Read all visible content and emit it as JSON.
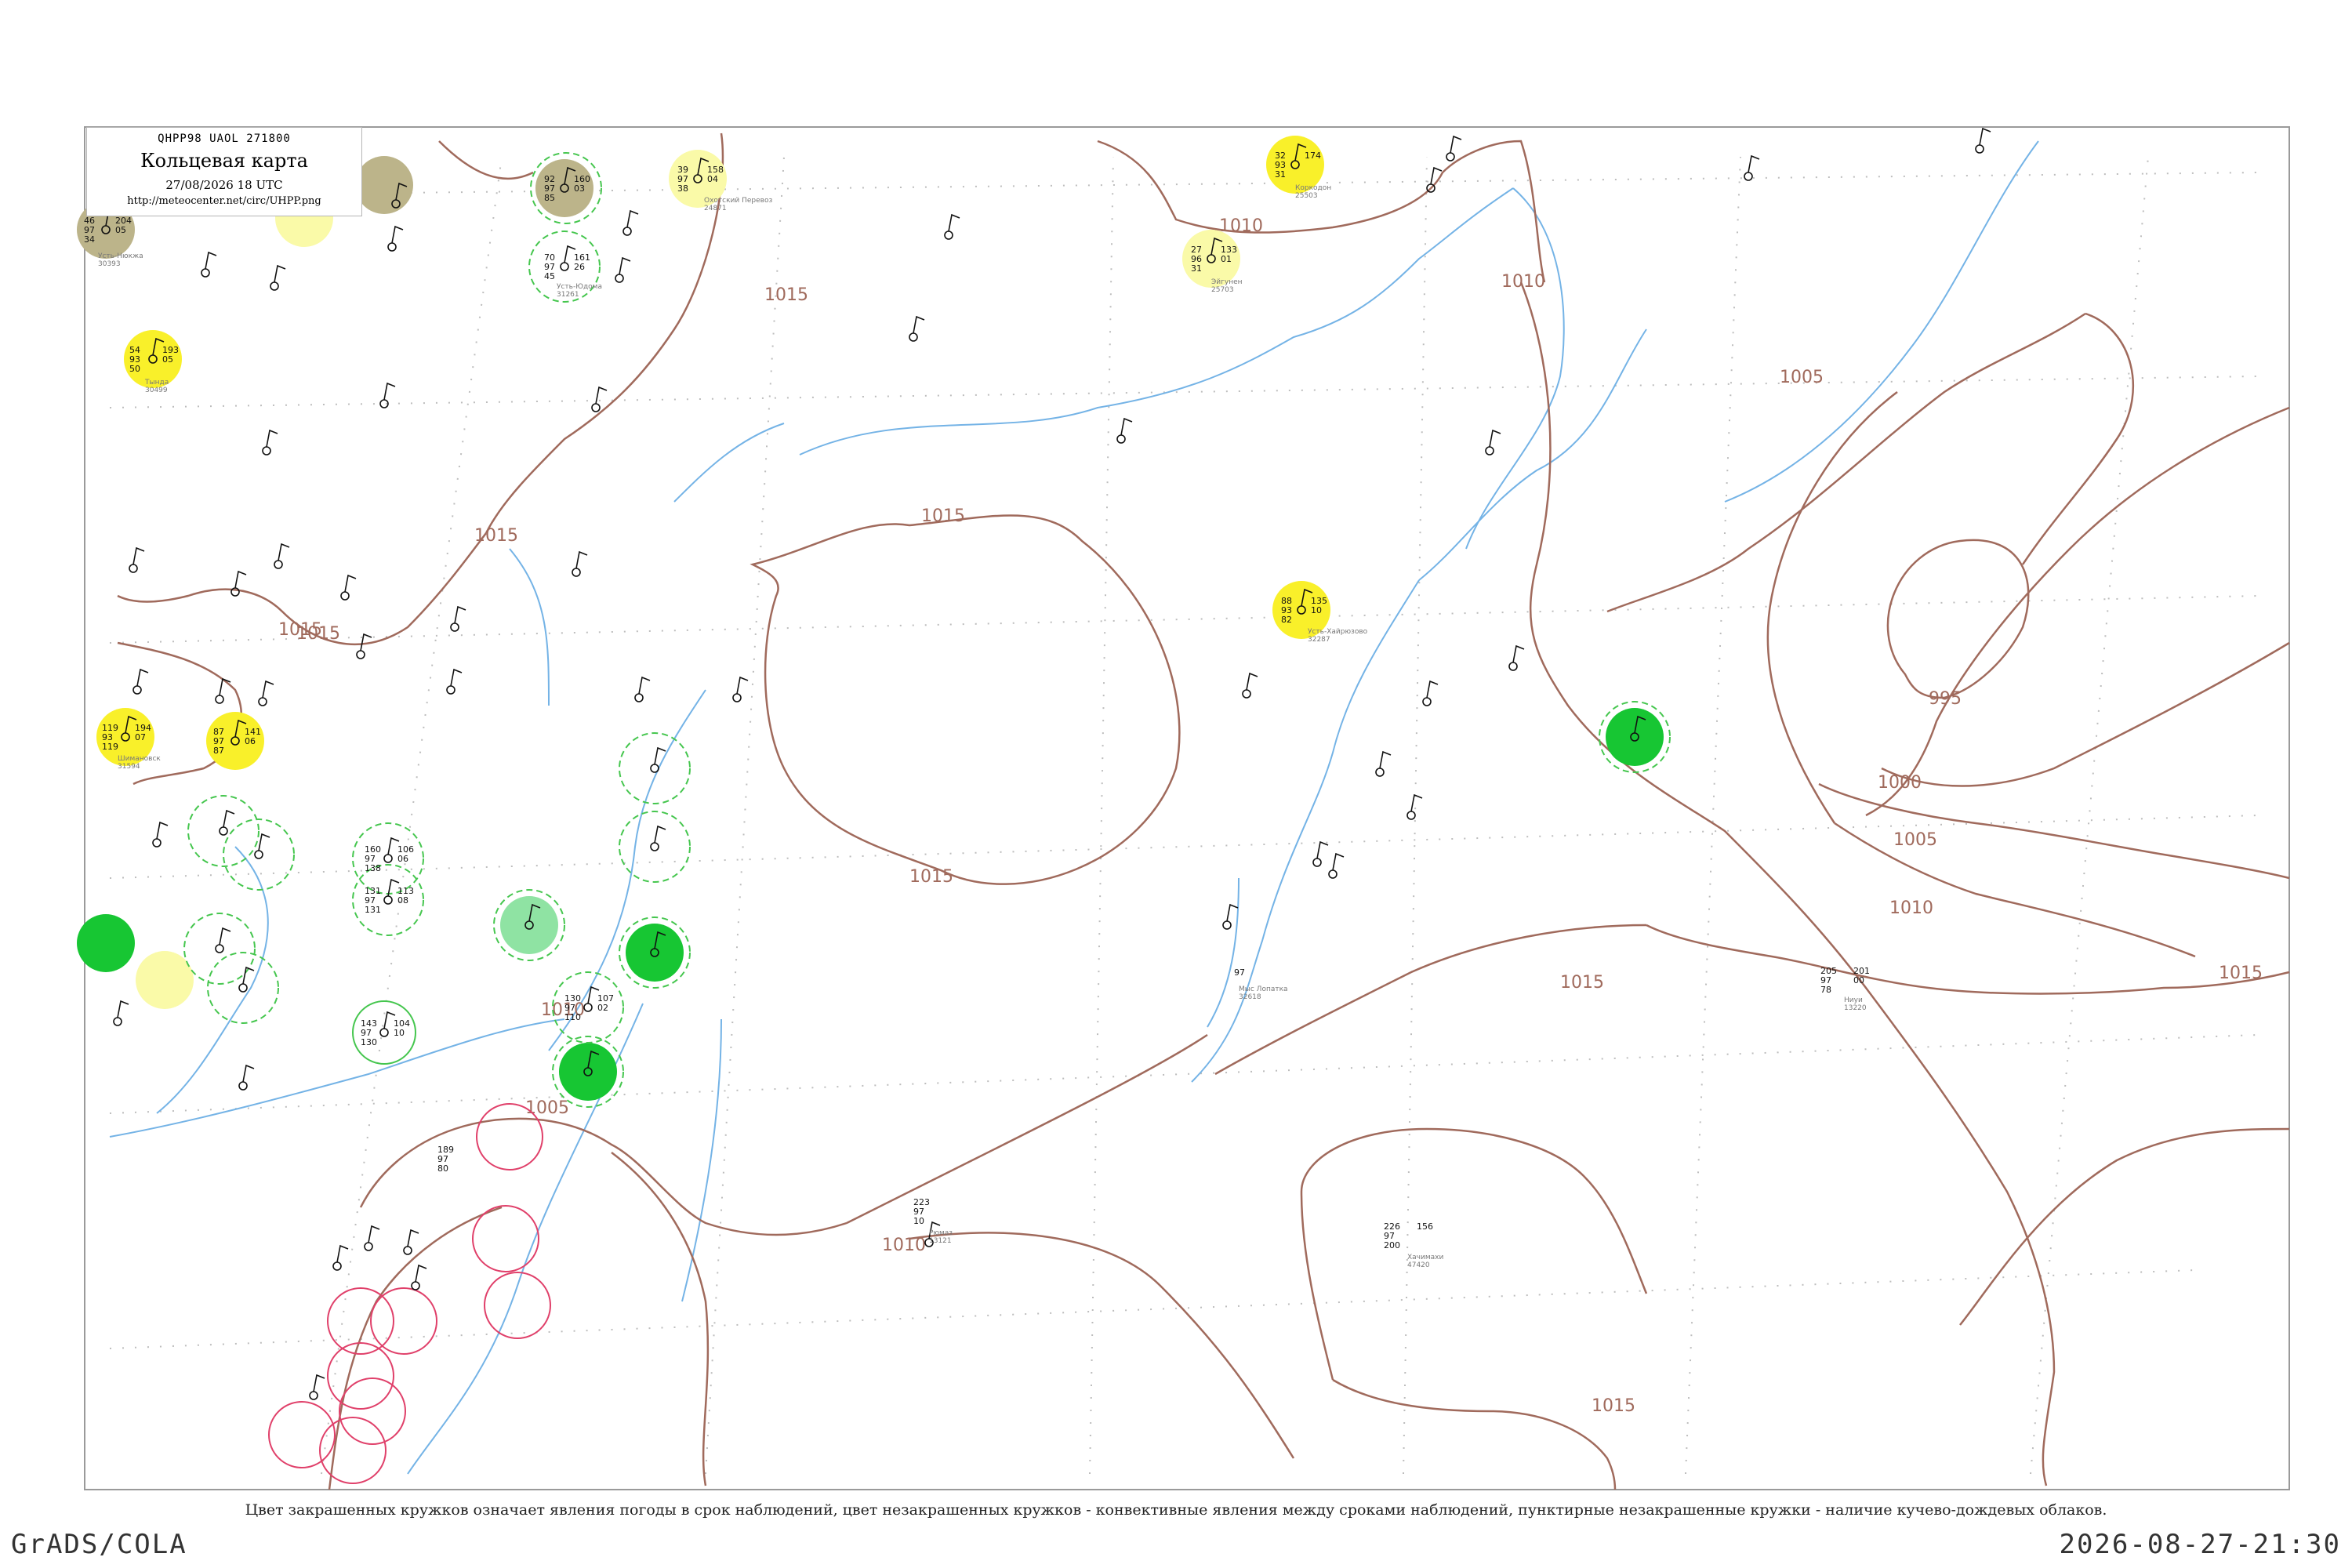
{
  "title": {
    "code": "QHPP98  UAOL  271800",
    "name": "Кольцевая карта",
    "datetime": "27/08/2026 18 UTC",
    "url": "http://meteocenter.net/circ/UHPP.png"
  },
  "isobar_labels": [
    "1015",
    "1015",
    "1015",
    "1015",
    "1015",
    "1010",
    "1010",
    "1010",
    "1010",
    "1010",
    "1005",
    "1005",
    "1005",
    "1000",
    "995",
    "1015",
    "1015",
    "1015",
    "1015"
  ],
  "stations": [
    {
      "top": "46",
      "mid": "97",
      "bot": "34",
      "right_top": "204",
      "right_bot": "05",
      "name": "Усть-Нюкжа",
      "code": "30393"
    },
    {
      "top": "54",
      "mid": "93",
      "bot": "50",
      "right_top": "193",
      "right_bot": "05",
      "name": "Тында",
      "code": "30499"
    },
    {
      "top": "119",
      "mid": "93",
      "bot": "119",
      "right_top": "194",
      "right_bot": "07",
      "name": "Шимановск",
      "code": "31594"
    },
    {
      "top": "87",
      "mid": "97",
      "bot": "87",
      "right_top": "141",
      "right_bot": "06",
      "name": "",
      "code": ""
    },
    {
      "top": "92",
      "mid": "97",
      "bot": "85",
      "right_top": "160",
      "right_bot": "03",
      "name": "",
      "code": ""
    },
    {
      "top": "70",
      "mid": "97",
      "bot": "45",
      "right_top": "161",
      "right_bot": "26",
      "name": "Усть-Юдома",
      "code": "31261"
    },
    {
      "top": "39",
      "mid": "97",
      "bot": "38",
      "right_top": "158",
      "right_bot": "04",
      "name": "Охотский Перевоз",
      "code": "24871"
    },
    {
      "top": "32",
      "mid": "93",
      "bot": "31",
      "right_top": "174",
      "right_bot": "",
      "name": "Коркодон",
      "code": "25503"
    },
    {
      "top": "27",
      "mid": "96",
      "bot": "31",
      "right_top": "133",
      "right_bot": "01",
      "name": "Эйгунен",
      "code": "25703"
    },
    {
      "top": "88",
      "mid": "93",
      "bot": "82",
      "right_top": "135",
      "right_bot": "10",
      "name": "Усть-Хайрюзово",
      "code": "32287"
    },
    {
      "top": "",
      "mid": "97",
      "bot": "",
      "right_top": "",
      "right_bot": "",
      "name": "Мыс Лопатка",
      "code": "32618"
    },
    {
      "top": "160",
      "mid": "97",
      "bot": "138",
      "right_top": "106",
      "right_bot": "06",
      "name": "",
      "code": ""
    },
    {
      "top": "131",
      "mid": "97",
      "bot": "131",
      "right_top": "113",
      "right_bot": "08",
      "name": "",
      "code": ""
    },
    {
      "top": "130",
      "mid": "97",
      "bot": "110",
      "right_top": "107",
      "right_bot": "02",
      "name": "",
      "code": ""
    },
    {
      "top": "143",
      "mid": "97",
      "bot": "130",
      "right_top": "104",
      "right_bot": "10",
      "name": "",
      "code": ""
    },
    {
      "top": "189",
      "mid": "97",
      "bot": "80",
      "right_top": "",
      "right_bot": "",
      "name": "",
      "code": ""
    },
    {
      "top": "223",
      "mid": "97",
      "bot": "10",
      "right_top": "",
      "right_bot": "",
      "name": "Рюмаз",
      "code": "13121"
    },
    {
      "top": "226",
      "mid": "97",
      "bot": "200",
      "right_top": "156",
      "right_bot": "",
      "name": "Хачимахи",
      "code": "47420"
    },
    {
      "top": "205",
      "mid": "97",
      "bot": "78",
      "right_top": "201",
      "right_bot": "00",
      "name": "Ниуи",
      "code": "13220"
    }
  ],
  "caption": "Цвет закрашенных кружков означает явления погоды в срок наблюдений, цвет незакрашенных кружков - конвективные явления между сроками наблюдений, пунктирные незакрашенные кружки - наличие кучево-дождевых облаков.",
  "footer": {
    "left": "GrADS/COLA",
    "right": "2026-08-27-21:30"
  }
}
